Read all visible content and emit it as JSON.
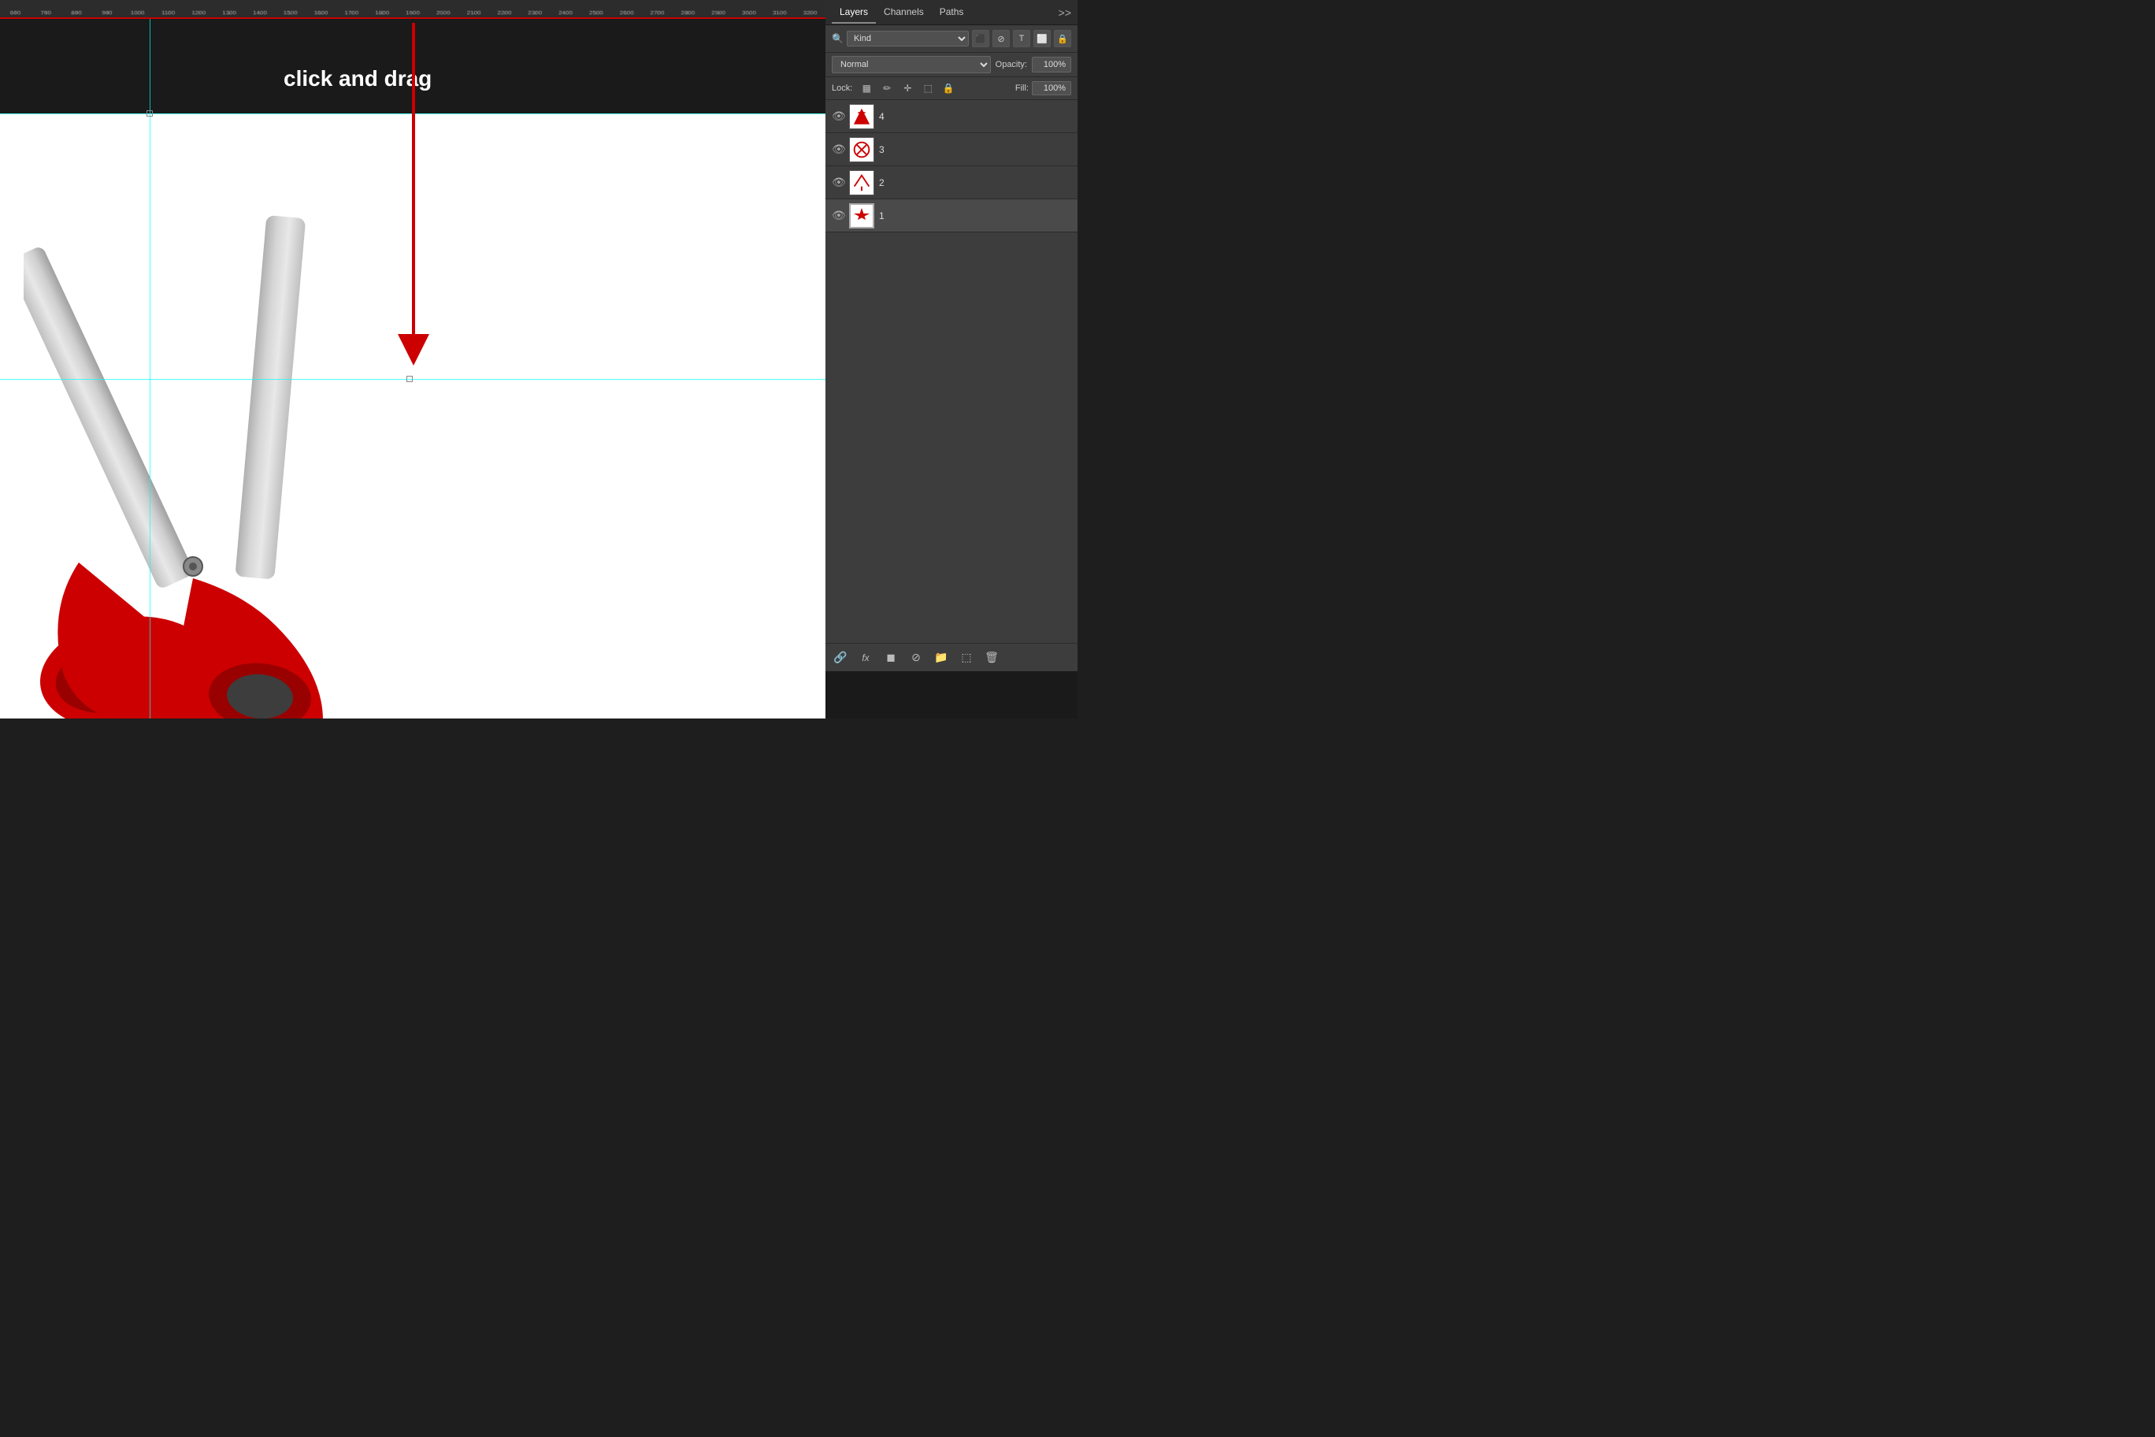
{
  "ruler": {
    "marks": [
      "600",
      "700",
      "800",
      "900",
      "1000",
      "1100",
      "1200",
      "1300",
      "1400",
      "1500",
      "1600",
      "1700",
      "1800",
      "1900",
      "2000",
      "2100",
      "2200",
      "2300",
      "2400",
      "2500",
      "2600",
      "2700",
      "2800",
      "2900",
      "3000",
      "3100",
      "3200"
    ]
  },
  "annotation": {
    "text": "click and drag"
  },
  "panel": {
    "tabs": [
      {
        "label": "Layers",
        "active": true
      },
      {
        "label": "Channels",
        "active": false
      },
      {
        "label": "Paths",
        "active": false
      }
    ],
    "more_icon": ">>",
    "filter": {
      "icon": "🔍",
      "kind_label": "Kind"
    },
    "blend_mode": "Normal",
    "opacity_label": "Opacity:",
    "opacity_value": "100%",
    "lock_label": "Lock:",
    "fill_label": "Fill:",
    "fill_value": "100%",
    "layers": [
      {
        "id": 4,
        "name": "4",
        "visible": true,
        "selected": false
      },
      {
        "id": 3,
        "name": "3",
        "visible": true,
        "selected": false
      },
      {
        "id": 2,
        "name": "2",
        "visible": true,
        "selected": false
      },
      {
        "id": 1,
        "name": "1",
        "visible": true,
        "selected": true
      }
    ]
  },
  "bottom_toolbar": {
    "buttons": [
      "🔗",
      "fx",
      "◼",
      "⊘",
      "📁",
      "⬚",
      "🗑"
    ]
  }
}
